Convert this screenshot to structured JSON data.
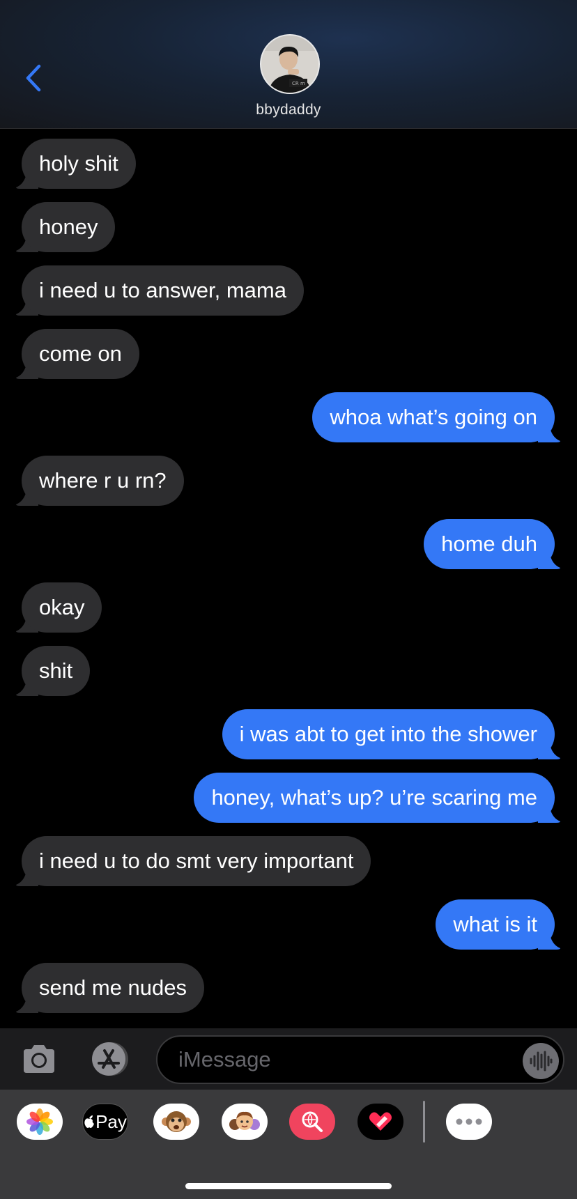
{
  "header": {
    "contact_name": "bbydaddy"
  },
  "messages": [
    {
      "dir": "in",
      "text": "holy shit"
    },
    {
      "dir": "in",
      "text": "honey"
    },
    {
      "dir": "in",
      "text": "i need u to answer, mama"
    },
    {
      "dir": "in",
      "text": "come on"
    },
    {
      "dir": "out",
      "text": "whoa what’s going on"
    },
    {
      "dir": "in",
      "text": "where r u rn?"
    },
    {
      "dir": "out",
      "text": "home duh"
    },
    {
      "dir": "in",
      "text": "okay"
    },
    {
      "dir": "in",
      "text": "shit"
    },
    {
      "dir": "out",
      "text": "i was abt to get into the shower"
    },
    {
      "dir": "out",
      "text": "honey, what’s up? u’re scaring me"
    },
    {
      "dir": "in",
      "text": "i need u to do smt very important"
    },
    {
      "dir": "out",
      "text": "what is it"
    },
    {
      "dir": "in",
      "text": "send me nudes"
    }
  ],
  "input": {
    "placeholder": "iMessage"
  },
  "app_drawer": {
    "items": [
      {
        "icon": "photos-icon"
      },
      {
        "icon": "apple-pay-icon",
        "label": "Pay"
      },
      {
        "icon": "animoji-icon"
      },
      {
        "icon": "memoji-icon"
      },
      {
        "icon": "images-search-icon"
      },
      {
        "icon": "digital-touch-icon"
      },
      {
        "icon": "more-icon"
      }
    ]
  },
  "colors": {
    "incoming_bubble": "#2e2e30",
    "outgoing_bubble": "#3478f6",
    "accent": "#3478f6",
    "background": "#000000"
  }
}
